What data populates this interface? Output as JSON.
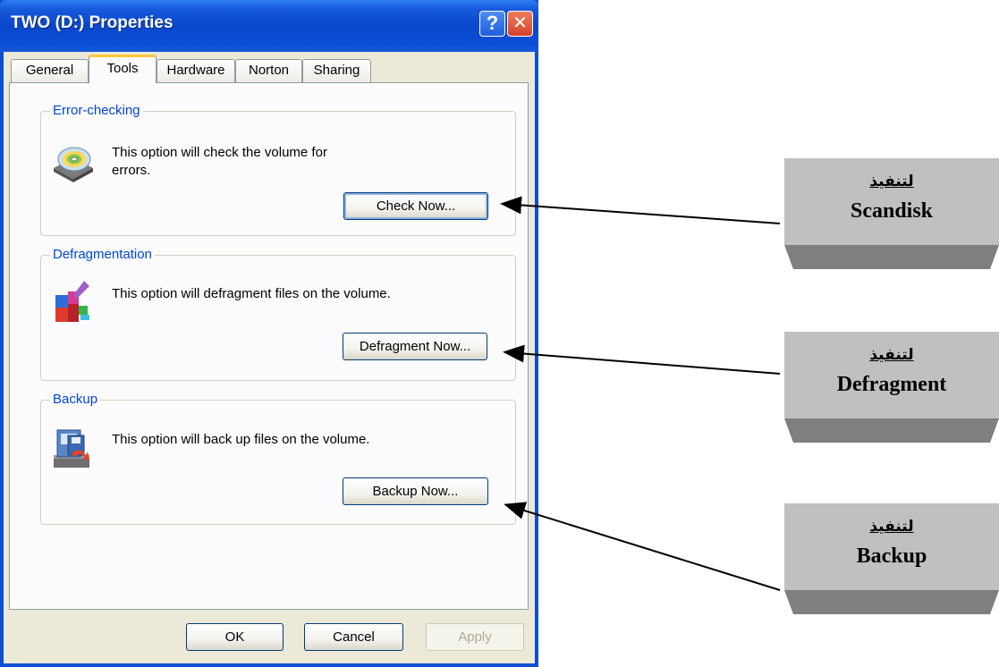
{
  "window": {
    "title": "TWO (D:) Properties",
    "help_label": "?",
    "close_label": "✕"
  },
  "tabs": [
    {
      "label": "General",
      "active": false
    },
    {
      "label": "Tools",
      "active": true
    },
    {
      "label": "Hardware",
      "active": false
    },
    {
      "label": "Norton",
      "active": false
    },
    {
      "label": "Sharing",
      "active": false
    }
  ],
  "sections": {
    "error_checking": {
      "title": "Error-checking",
      "text_line1": "This option will check the volume for",
      "text_line2": "errors.",
      "button": "Check Now...",
      "icon": "disk-check-icon"
    },
    "defragmentation": {
      "title": "Defragmentation",
      "text": "This option will defragment files on the volume.",
      "button": "Defragment Now...",
      "icon": "defragment-icon"
    },
    "backup": {
      "title": "Backup",
      "text": "This option will back up files on the volume.",
      "button": "Backup Now...",
      "icon": "backup-icon"
    }
  },
  "footer": {
    "ok": "OK",
    "cancel": "Cancel",
    "apply": "Apply"
  },
  "callouts": [
    {
      "arabic": "لتنفيذ",
      "english": "Scandisk"
    },
    {
      "arabic": "لتنفيذ",
      "english": "Defragment"
    },
    {
      "arabic": "لتنفيذ",
      "english": "Backup"
    }
  ],
  "colors": {
    "titlebar": "#0b4fd2",
    "group_title": "#0046d5",
    "dialog_bg": "#ece9d8",
    "tab_highlight": "#ffc83c",
    "callout_box": "#c0c0c0"
  }
}
